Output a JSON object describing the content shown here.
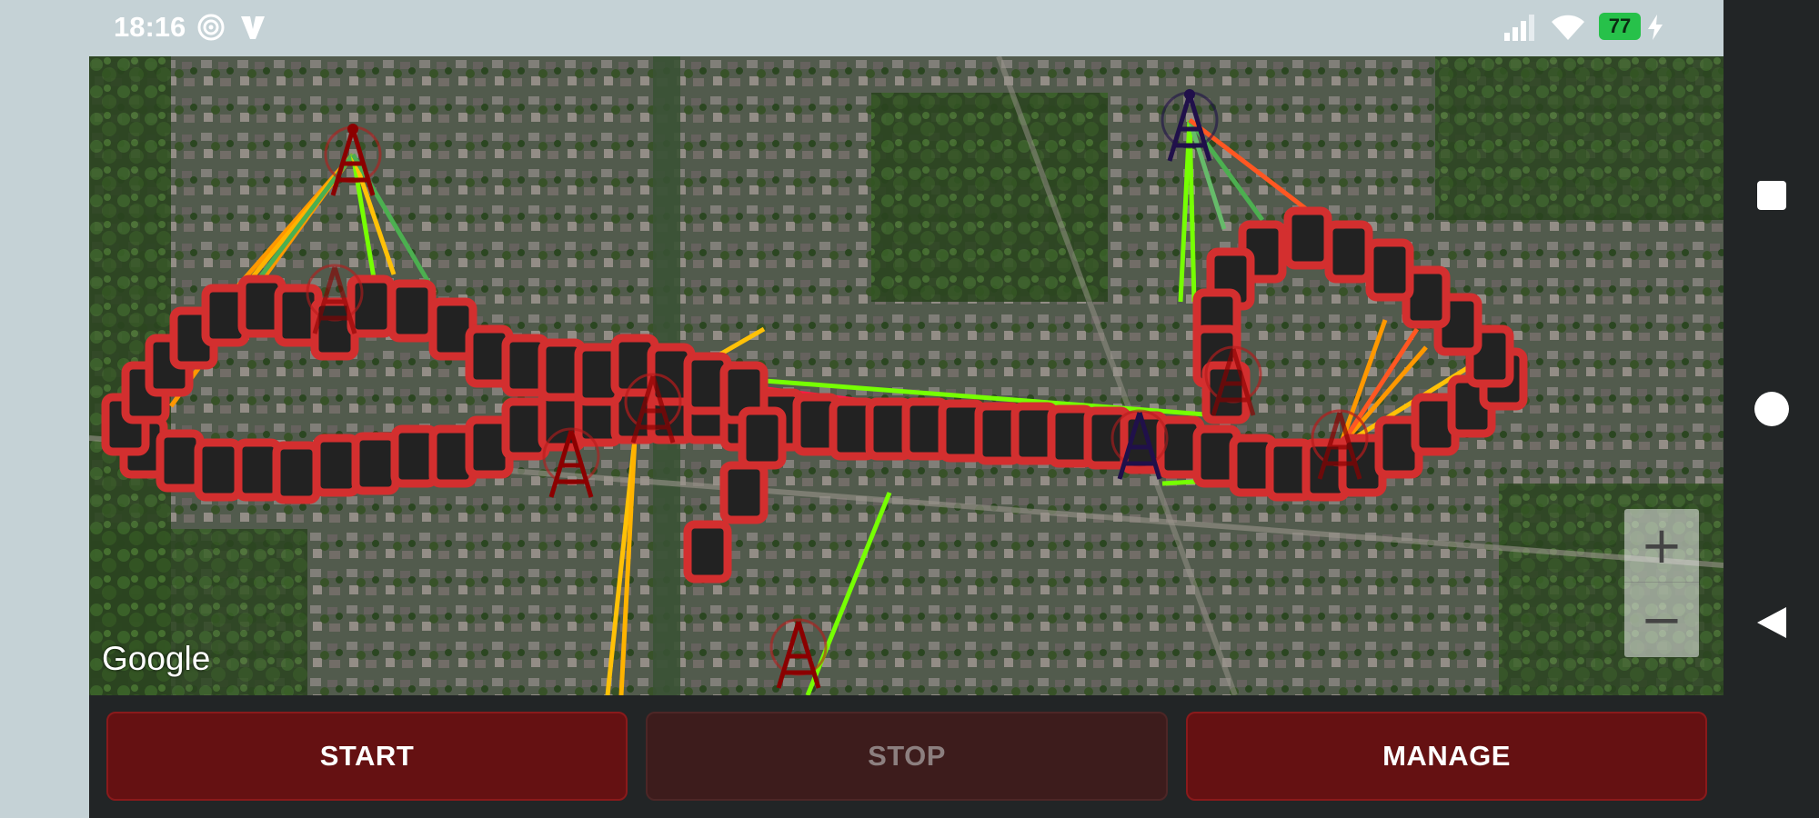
{
  "status_bar": {
    "time": "18:16",
    "icons": [
      "hotspot-icon",
      "vpn-v-icon"
    ],
    "right_icons": [
      "signal-icon",
      "wifi-icon",
      "charging-icon"
    ],
    "battery_level": "77"
  },
  "map": {
    "provider_label": "Google",
    "zoom_in_label": "+",
    "zoom_out_label": "−",
    "link_colors": [
      "#ff9800",
      "#ffc107",
      "#4caf50",
      "#76ff03",
      "#ff5722"
    ],
    "tower_color": "#8b0000",
    "tower_color_active": "#20104a",
    "marker_fill": "#222222",
    "marker_border": "#d32f2f"
  },
  "controls": {
    "start_label": "START",
    "stop_label": "STOP",
    "manage_label": "MANAGE"
  },
  "nav_bar": {
    "items": [
      "recents-square-icon",
      "home-circle-icon",
      "back-triangle-icon"
    ]
  }
}
